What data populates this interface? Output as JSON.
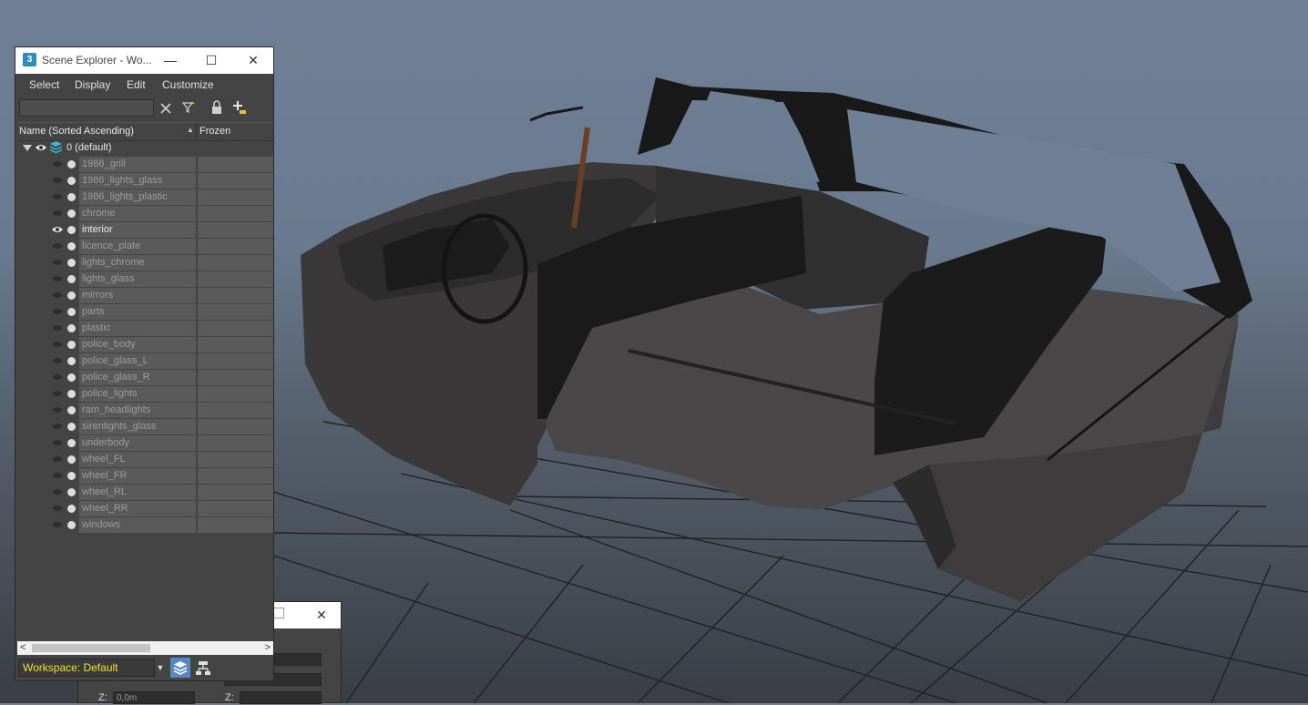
{
  "scene_explorer": {
    "app_icon": "3",
    "title": "Scene Explorer - Wo...",
    "window_buttons": {
      "minimize": "—",
      "maximize": "☐",
      "close": "✕"
    },
    "menu": [
      "Select",
      "Display",
      "Edit",
      "Customize"
    ],
    "search": {
      "value": "",
      "placeholder": ""
    },
    "toolbar_icons": [
      "close-x-icon",
      "filter-icon",
      "lock-icon",
      "add-layer-icon"
    ],
    "columns": {
      "name": "Name (Sorted Ascending)",
      "frozen": "Frozen"
    },
    "layer": {
      "name": "0 (default)"
    },
    "items": [
      {
        "name": "1986_grill",
        "visible": false
      },
      {
        "name": "1986_lights_glass",
        "visible": false
      },
      {
        "name": "1986_lights_plastic",
        "visible": false
      },
      {
        "name": "chrome",
        "visible": false
      },
      {
        "name": "interior",
        "visible": true
      },
      {
        "name": "licence_plate",
        "visible": false
      },
      {
        "name": "lights_chrome",
        "visible": false
      },
      {
        "name": "lights_glass",
        "visible": false
      },
      {
        "name": "mirrors",
        "visible": false
      },
      {
        "name": "parts",
        "visible": false
      },
      {
        "name": "plastic",
        "visible": false
      },
      {
        "name": "police_body",
        "visible": false
      },
      {
        "name": "police_glass_L",
        "visible": false
      },
      {
        "name": "police_glass_R",
        "visible": false
      },
      {
        "name": "police_lights",
        "visible": false
      },
      {
        "name": "ram_headlights",
        "visible": false
      },
      {
        "name": "sirenlights_glass",
        "visible": false
      },
      {
        "name": "underbody",
        "visible": false
      },
      {
        "name": "wheel_FL",
        "visible": false
      },
      {
        "name": "wheel_FR",
        "visible": false
      },
      {
        "name": "wheel_RL",
        "visible": false
      },
      {
        "name": "wheel_RR",
        "visible": false
      },
      {
        "name": "windows",
        "visible": false
      }
    ],
    "workspace": "Workspace: Default"
  },
  "second_window": {
    "close": "✕",
    "z_label_left": "Z:",
    "z_value_left": "0,0m",
    "z_label_right": "Z:"
  },
  "colors": {
    "panel_bg": "#444444",
    "row_bg": "#5a5a5a",
    "workspace_text": "#f0e030",
    "active_button": "#5688c4"
  }
}
